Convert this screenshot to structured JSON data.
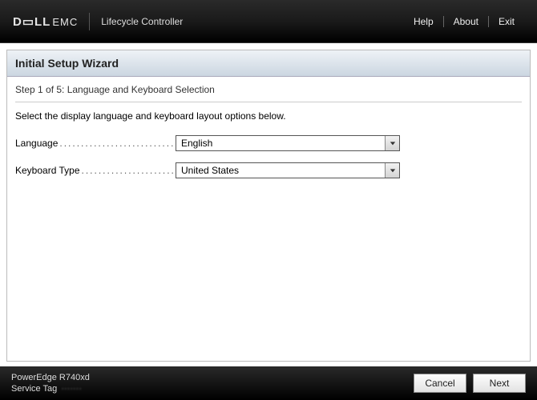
{
  "header": {
    "logo_main": "D▭LL",
    "logo_sub": "EMC",
    "product": "Lifecycle Controller",
    "links": {
      "help": "Help",
      "about": "About",
      "exit": "Exit"
    }
  },
  "wizard": {
    "title": "Initial Setup Wizard",
    "step_line": "Step 1 of 5: Language and Keyboard Selection",
    "instruction": "Select the display language and keyboard layout options below.",
    "language": {
      "label": "Language",
      "value": "English"
    },
    "keyboard": {
      "label": "Keyboard Type",
      "value": "United States"
    }
  },
  "footer": {
    "model": "PowerEdge R740xd",
    "service_tag_label": "Service Tag",
    "service_tag_value": "·······",
    "buttons": {
      "cancel": "Cancel",
      "next": "Next"
    }
  }
}
